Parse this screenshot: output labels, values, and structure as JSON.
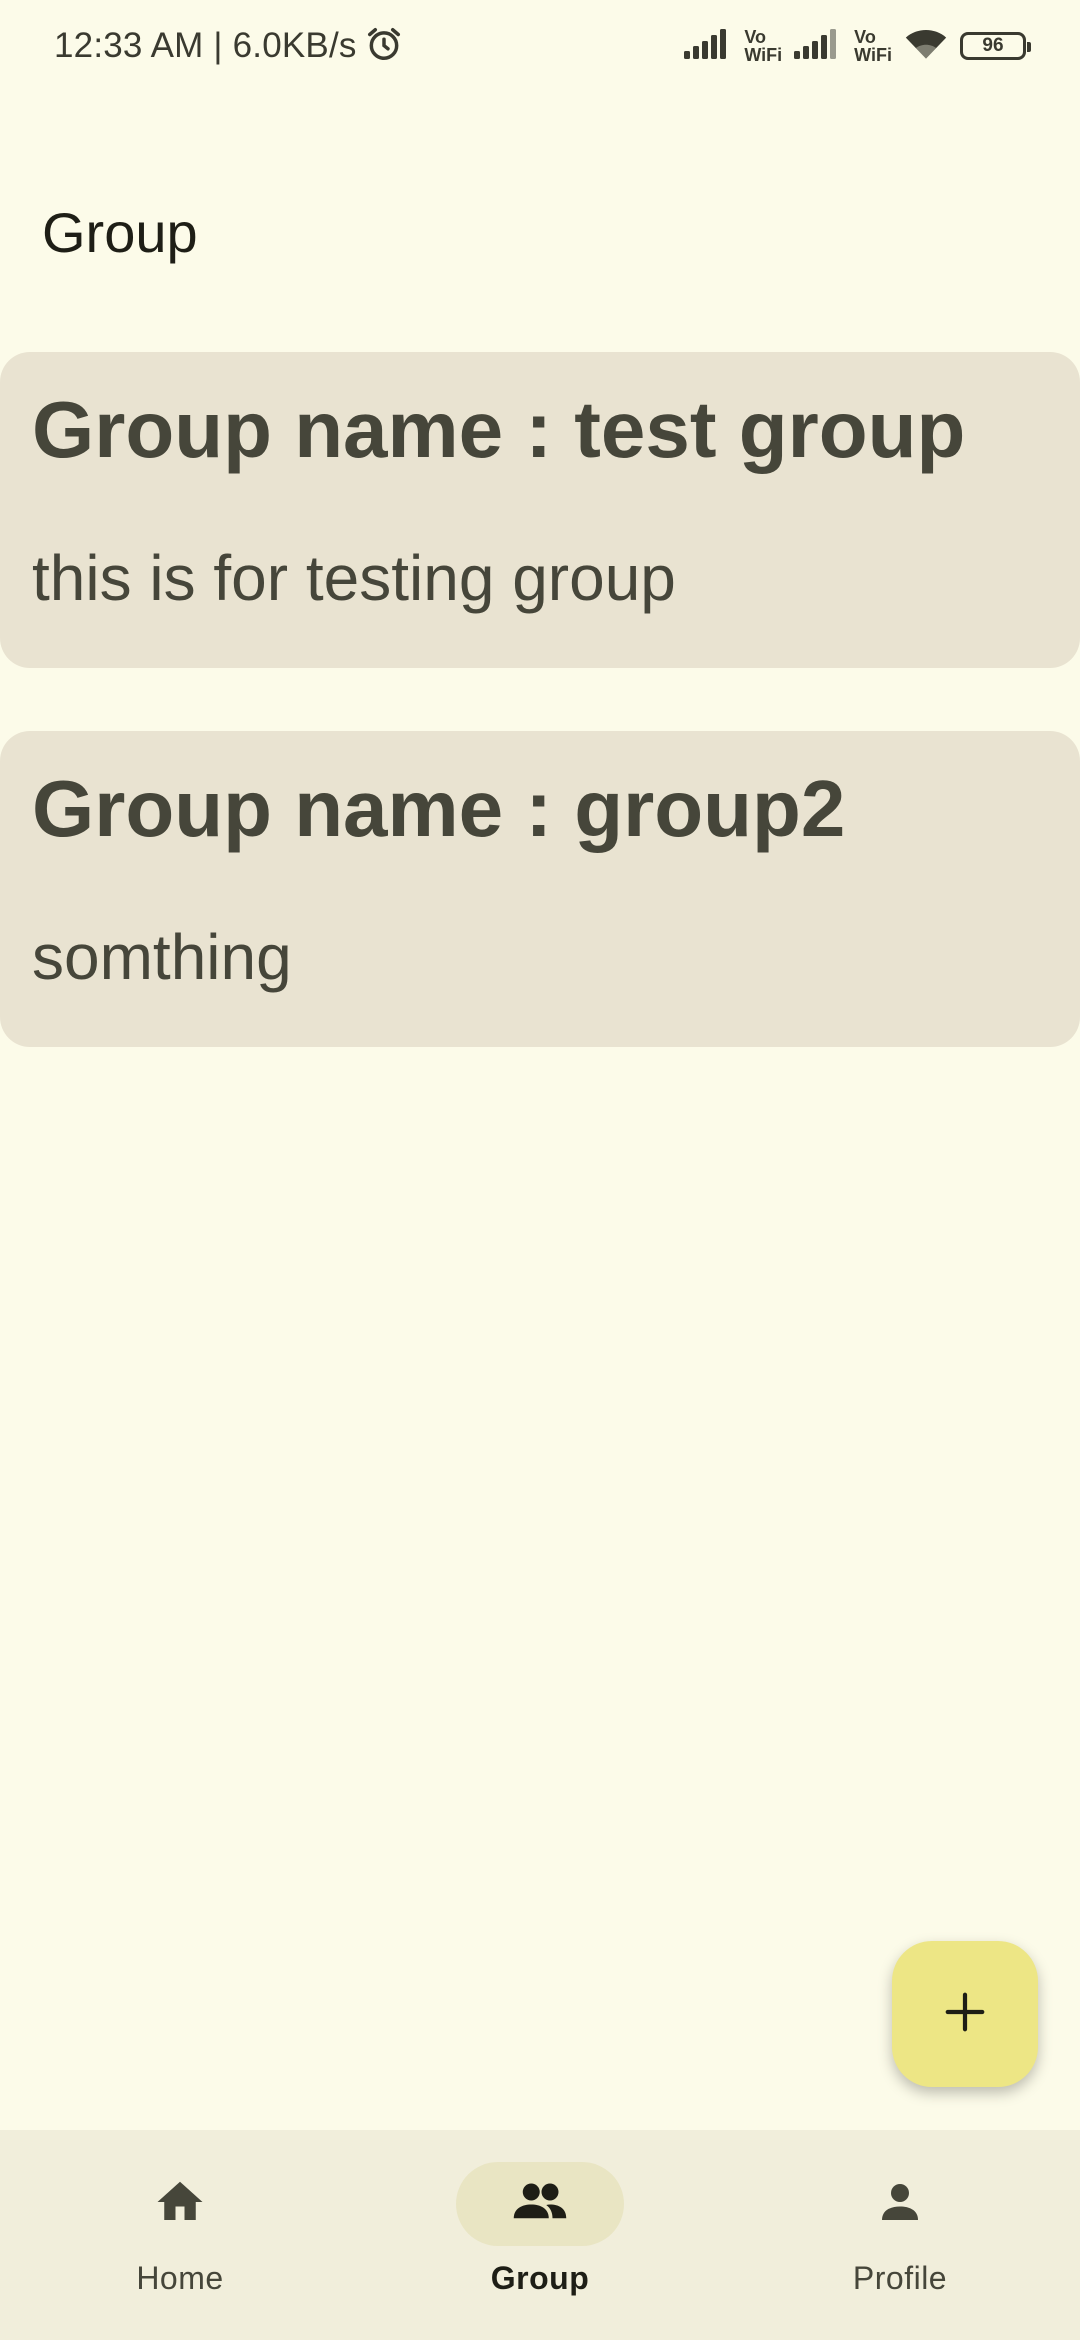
{
  "status_bar": {
    "time_speed": "12:33 AM | 6.0KB/s",
    "sim1_label_top": "Vo",
    "sim1_label_bottom": "WiFi",
    "sim2_label_top": "Vo",
    "sim2_label_bottom": "WiFi",
    "battery": "96"
  },
  "header": {
    "title": "Group"
  },
  "groups": [
    {
      "title": "Group name : test group",
      "description": "this is for testing group"
    },
    {
      "title": "Group name : group2",
      "description": "somthing"
    }
  ],
  "fab": {
    "icon": "plus-icon"
  },
  "bottom_nav": {
    "items": [
      {
        "label": "Home",
        "icon": "home-icon",
        "active": false
      },
      {
        "label": "Group",
        "icon": "group-icon",
        "active": true
      },
      {
        "label": "Profile",
        "icon": "person-icon",
        "active": false
      }
    ]
  },
  "colors": {
    "background": "#fcfbe9",
    "card": "#e9e3d1",
    "fab": "#ede685",
    "nav_bar": "#f1eedb",
    "nav_active_pill": "#e9e5c3",
    "text": "#46463a"
  }
}
